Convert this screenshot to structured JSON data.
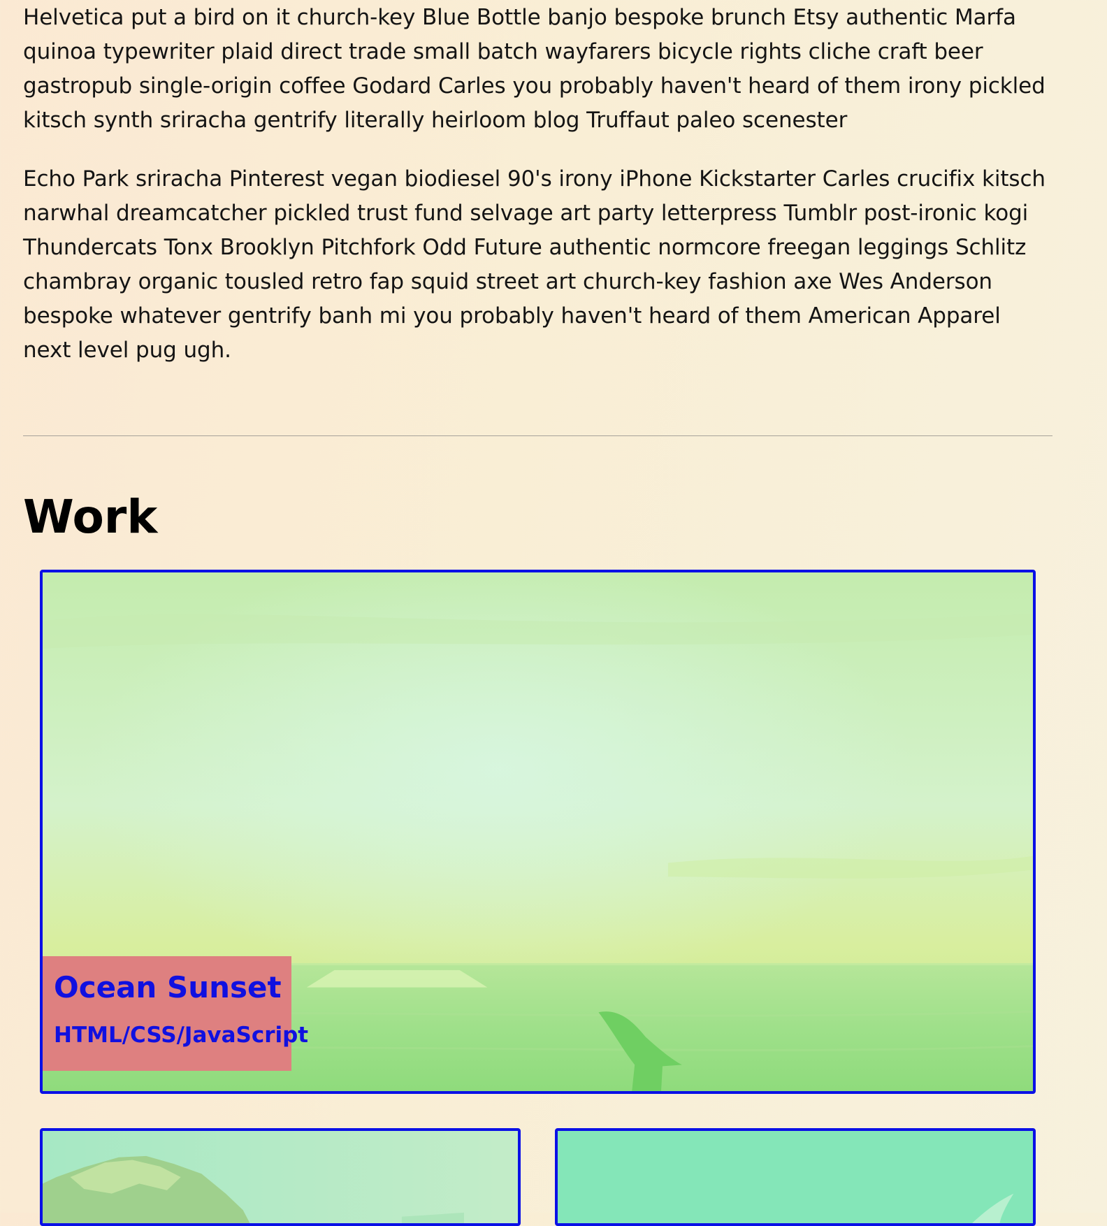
{
  "about": {
    "paragraph_1": "Helvetica put a bird on it church-key Blue Bottle banjo bespoke brunch Etsy authentic Marfa quinoa typewriter plaid direct trade small batch wayfarers bicycle rights cliche craft beer gastropub single-origin coffee Godard Carles you probably haven't heard of them irony pickled kitsch synth sriracha gentrify literally heirloom blog Truffaut paleo scenester",
    "paragraph_2": "Echo Park sriracha Pinterest vegan biodiesel 90's irony iPhone Kickstarter Carles crucifix kitsch narwhal dreamcatcher pickled trust fund selvage art party letterpress Tumblr post-ironic kogi Thundercats Tonx Brooklyn Pitchfork Odd Future authentic normcore freegan leggings Schlitz chambray organic tousled retro fap squid street art church-key fashion axe Wes Anderson bespoke whatever gentrify banh mi you probably haven't heard of them American Apparel next level pug ugh."
  },
  "work": {
    "heading": "Work",
    "projects": [
      {
        "title": "Ocean Sunset",
        "tech": "HTML/CSS/JavaScript",
        "image": "ocean-sunset-thumbnail"
      },
      {
        "title": "",
        "tech": "",
        "image": "mountain-thumbnail"
      },
      {
        "title": "",
        "tech": "",
        "image": "seabird-thumbnail"
      }
    ]
  },
  "colors": {
    "page_background": "#f9eed5",
    "card_border": "#0a10e6",
    "caption_background": "#de8080",
    "caption_text": "#1010e0",
    "divider": "#a6a29a"
  }
}
